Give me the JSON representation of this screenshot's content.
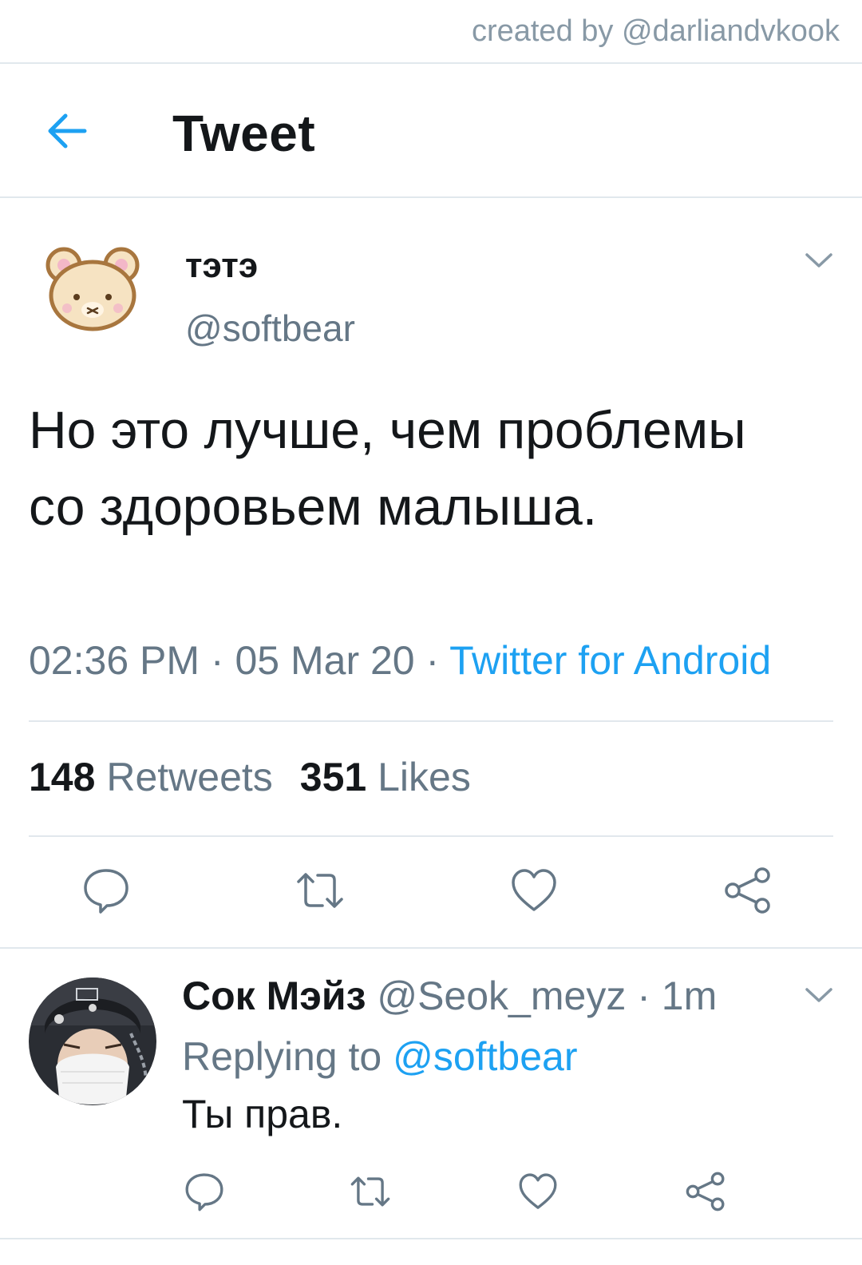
{
  "watermark": "created by @darliandvkook",
  "header": {
    "title": "Tweet",
    "back_icon": "arrow-left-icon"
  },
  "tweet": {
    "author_name": "тэтэ",
    "author_handle": "@softbear",
    "text": "Но это лучше, чем проблемы со здоровьем малыша.",
    "time": "02:36 PM",
    "date": "05 Mar 20",
    "separator": "·",
    "source": "Twitter for Android",
    "retweets_count": "148",
    "retweets_label": "Retweets",
    "likes_count": "351",
    "likes_label": "Likes"
  },
  "reply": {
    "author_name": "Сок Мэйз",
    "author_handle": "@Seok_meyz",
    "separator": "·",
    "time_ago": "1m",
    "replying_label": "Replying to",
    "replying_to": "@softbear",
    "text": "Ты прав."
  },
  "colors": {
    "accent": "#1da1f2",
    "text": "#14171a",
    "muted": "#657786",
    "divider": "#e1e8ed"
  },
  "icons": [
    "arrow-left-icon",
    "chevron-down-icon",
    "reply-icon",
    "retweet-icon",
    "like-icon",
    "share-icon"
  ]
}
